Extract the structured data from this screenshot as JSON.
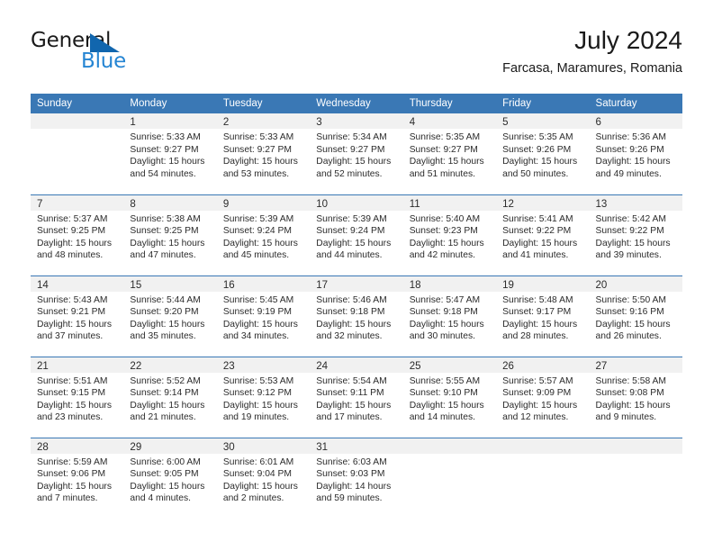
{
  "brand": {
    "line1": "General",
    "line2": "Blue",
    "triangle_color": "#1166ae",
    "blue_color": "#2585d3"
  },
  "header": {
    "month_title": "July 2024",
    "location": "Farcasa, Maramures, Romania"
  },
  "theme": {
    "header_blue": "#3a78b5",
    "daynum_band": "#f1f1f1",
    "text": "#2b2b2b"
  },
  "calendar": {
    "weekday_headers": [
      "Sunday",
      "Monday",
      "Tuesday",
      "Wednesday",
      "Thursday",
      "Friday",
      "Saturday"
    ],
    "weeks": [
      [
        {
          "day": "",
          "sunrise": "",
          "sunset": "",
          "daylight1": "",
          "daylight2": "",
          "empty": true
        },
        {
          "day": "1",
          "sunrise": "Sunrise: 5:33 AM",
          "sunset": "Sunset: 9:27 PM",
          "daylight1": "Daylight: 15 hours",
          "daylight2": "and 54 minutes."
        },
        {
          "day": "2",
          "sunrise": "Sunrise: 5:33 AM",
          "sunset": "Sunset: 9:27 PM",
          "daylight1": "Daylight: 15 hours",
          "daylight2": "and 53 minutes."
        },
        {
          "day": "3",
          "sunrise": "Sunrise: 5:34 AM",
          "sunset": "Sunset: 9:27 PM",
          "daylight1": "Daylight: 15 hours",
          "daylight2": "and 52 minutes."
        },
        {
          "day": "4",
          "sunrise": "Sunrise: 5:35 AM",
          "sunset": "Sunset: 9:27 PM",
          "daylight1": "Daylight: 15 hours",
          "daylight2": "and 51 minutes."
        },
        {
          "day": "5",
          "sunrise": "Sunrise: 5:35 AM",
          "sunset": "Sunset: 9:26 PM",
          "daylight1": "Daylight: 15 hours",
          "daylight2": "and 50 minutes."
        },
        {
          "day": "6",
          "sunrise": "Sunrise: 5:36 AM",
          "sunset": "Sunset: 9:26 PM",
          "daylight1": "Daylight: 15 hours",
          "daylight2": "and 49 minutes."
        }
      ],
      [
        {
          "day": "7",
          "sunrise": "Sunrise: 5:37 AM",
          "sunset": "Sunset: 9:25 PM",
          "daylight1": "Daylight: 15 hours",
          "daylight2": "and 48 minutes."
        },
        {
          "day": "8",
          "sunrise": "Sunrise: 5:38 AM",
          "sunset": "Sunset: 9:25 PM",
          "daylight1": "Daylight: 15 hours",
          "daylight2": "and 47 minutes."
        },
        {
          "day": "9",
          "sunrise": "Sunrise: 5:39 AM",
          "sunset": "Sunset: 9:24 PM",
          "daylight1": "Daylight: 15 hours",
          "daylight2": "and 45 minutes."
        },
        {
          "day": "10",
          "sunrise": "Sunrise: 5:39 AM",
          "sunset": "Sunset: 9:24 PM",
          "daylight1": "Daylight: 15 hours",
          "daylight2": "and 44 minutes."
        },
        {
          "day": "11",
          "sunrise": "Sunrise: 5:40 AM",
          "sunset": "Sunset: 9:23 PM",
          "daylight1": "Daylight: 15 hours",
          "daylight2": "and 42 minutes."
        },
        {
          "day": "12",
          "sunrise": "Sunrise: 5:41 AM",
          "sunset": "Sunset: 9:22 PM",
          "daylight1": "Daylight: 15 hours",
          "daylight2": "and 41 minutes."
        },
        {
          "day": "13",
          "sunrise": "Sunrise: 5:42 AM",
          "sunset": "Sunset: 9:22 PM",
          "daylight1": "Daylight: 15 hours",
          "daylight2": "and 39 minutes."
        }
      ],
      [
        {
          "day": "14",
          "sunrise": "Sunrise: 5:43 AM",
          "sunset": "Sunset: 9:21 PM",
          "daylight1": "Daylight: 15 hours",
          "daylight2": "and 37 minutes."
        },
        {
          "day": "15",
          "sunrise": "Sunrise: 5:44 AM",
          "sunset": "Sunset: 9:20 PM",
          "daylight1": "Daylight: 15 hours",
          "daylight2": "and 35 minutes."
        },
        {
          "day": "16",
          "sunrise": "Sunrise: 5:45 AM",
          "sunset": "Sunset: 9:19 PM",
          "daylight1": "Daylight: 15 hours",
          "daylight2": "and 34 minutes."
        },
        {
          "day": "17",
          "sunrise": "Sunrise: 5:46 AM",
          "sunset": "Sunset: 9:18 PM",
          "daylight1": "Daylight: 15 hours",
          "daylight2": "and 32 minutes."
        },
        {
          "day": "18",
          "sunrise": "Sunrise: 5:47 AM",
          "sunset": "Sunset: 9:18 PM",
          "daylight1": "Daylight: 15 hours",
          "daylight2": "and 30 minutes."
        },
        {
          "day": "19",
          "sunrise": "Sunrise: 5:48 AM",
          "sunset": "Sunset: 9:17 PM",
          "daylight1": "Daylight: 15 hours",
          "daylight2": "and 28 minutes."
        },
        {
          "day": "20",
          "sunrise": "Sunrise: 5:50 AM",
          "sunset": "Sunset: 9:16 PM",
          "daylight1": "Daylight: 15 hours",
          "daylight2": "and 26 minutes."
        }
      ],
      [
        {
          "day": "21",
          "sunrise": "Sunrise: 5:51 AM",
          "sunset": "Sunset: 9:15 PM",
          "daylight1": "Daylight: 15 hours",
          "daylight2": "and 23 minutes."
        },
        {
          "day": "22",
          "sunrise": "Sunrise: 5:52 AM",
          "sunset": "Sunset: 9:14 PM",
          "daylight1": "Daylight: 15 hours",
          "daylight2": "and 21 minutes."
        },
        {
          "day": "23",
          "sunrise": "Sunrise: 5:53 AM",
          "sunset": "Sunset: 9:12 PM",
          "daylight1": "Daylight: 15 hours",
          "daylight2": "and 19 minutes."
        },
        {
          "day": "24",
          "sunrise": "Sunrise: 5:54 AM",
          "sunset": "Sunset: 9:11 PM",
          "daylight1": "Daylight: 15 hours",
          "daylight2": "and 17 minutes."
        },
        {
          "day": "25",
          "sunrise": "Sunrise: 5:55 AM",
          "sunset": "Sunset: 9:10 PM",
          "daylight1": "Daylight: 15 hours",
          "daylight2": "and 14 minutes."
        },
        {
          "day": "26",
          "sunrise": "Sunrise: 5:57 AM",
          "sunset": "Sunset: 9:09 PM",
          "daylight1": "Daylight: 15 hours",
          "daylight2": "and 12 minutes."
        },
        {
          "day": "27",
          "sunrise": "Sunrise: 5:58 AM",
          "sunset": "Sunset: 9:08 PM",
          "daylight1": "Daylight: 15 hours",
          "daylight2": "and 9 minutes."
        }
      ],
      [
        {
          "day": "28",
          "sunrise": "Sunrise: 5:59 AM",
          "sunset": "Sunset: 9:06 PM",
          "daylight1": "Daylight: 15 hours",
          "daylight2": "and 7 minutes."
        },
        {
          "day": "29",
          "sunrise": "Sunrise: 6:00 AM",
          "sunset": "Sunset: 9:05 PM",
          "daylight1": "Daylight: 15 hours",
          "daylight2": "and 4 minutes."
        },
        {
          "day": "30",
          "sunrise": "Sunrise: 6:01 AM",
          "sunset": "Sunset: 9:04 PM",
          "daylight1": "Daylight: 15 hours",
          "daylight2": "and 2 minutes."
        },
        {
          "day": "31",
          "sunrise": "Sunrise: 6:03 AM",
          "sunset": "Sunset: 9:03 PM",
          "daylight1": "Daylight: 14 hours",
          "daylight2": "and 59 minutes."
        },
        {
          "day": "",
          "sunrise": "",
          "sunset": "",
          "daylight1": "",
          "daylight2": "",
          "empty": true
        },
        {
          "day": "",
          "sunrise": "",
          "sunset": "",
          "daylight1": "",
          "daylight2": "",
          "empty": true
        },
        {
          "day": "",
          "sunrise": "",
          "sunset": "",
          "daylight1": "",
          "daylight2": "",
          "empty": true
        }
      ]
    ]
  }
}
